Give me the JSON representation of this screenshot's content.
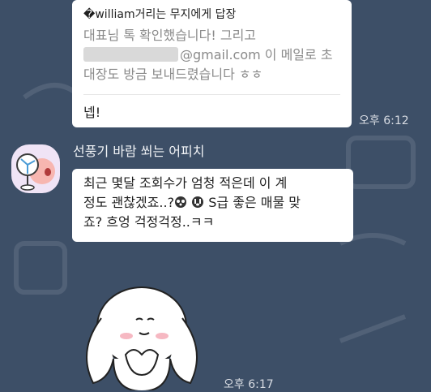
{
  "chat": {
    "reply": {
      "header": "�william거리는 무지에게 답장",
      "quote_line1": "대표님 톡 확인했습니다! 그리고",
      "quote_email_suffix": "@gmail.com  이 메일로 초",
      "quote_line3": "대장도 방금 보내드렸습니다 ㅎㅎ",
      "message": "넵!",
      "time": "오후 6:12"
    },
    "incoming": {
      "sender": "선풍기 바람 쐬는 어피치",
      "line1": "최근 몇달 조회수가 엄청 적은데 이 계",
      "line2_a": "정도 괜찮겠죠..?",
      "line2_b": "S급 좋은 매물 맞",
      "line3": "죠? 흐엉 걱정걱정..ㅋㅋ",
      "sticker_time": "오후 6:17"
    }
  },
  "icons": {
    "avatar": "apeach-fan-icon",
    "emoji1": "dizzy-face-icon",
    "emoji2": "crying-face-icon",
    "sticker": "puppy-sticker"
  }
}
